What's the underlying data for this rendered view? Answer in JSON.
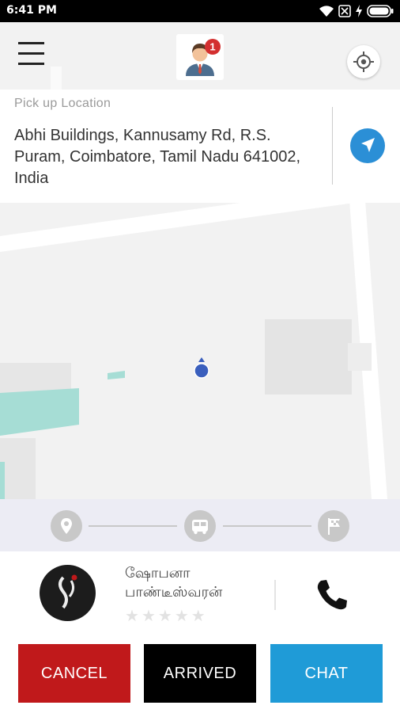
{
  "status_bar": {
    "time": "6:41 PM",
    "icons": [
      "wifi-icon",
      "sim-blocked-icon",
      "charging-icon",
      "battery-icon"
    ]
  },
  "header": {
    "menu_icon": "hamburger-menu-icon",
    "avatar_icon": "driver-avatar-icon",
    "notification_count": "1",
    "locate_icon": "my-location-icon"
  },
  "pickup": {
    "label": "Pick up Location",
    "address": "Abhi Buildings, Kannusamy Rd, R.S. Puram, Coimbatore, Tamil Nadu 641002, India",
    "navigate_icon": "navigation-arrow-icon"
  },
  "trip_progress": {
    "steps": [
      "location-pin-icon",
      "bus-icon",
      "finish-flag-icon"
    ]
  },
  "driver": {
    "name": "ஷோபனா பாண்டீஸ்வரன்",
    "rating_stars": 5,
    "rating_value": 0,
    "star_glyph": "★",
    "call_icon": "phone-icon"
  },
  "actions": {
    "cancel_label": "CANCEL",
    "arrived_label": "ARRIVED",
    "chat_label": "CHAT"
  },
  "colors": {
    "cancel": "#c0191b",
    "arrived": "#000000",
    "chat": "#1f9bd7",
    "accent_blue": "#2b8fd6",
    "notification_badge": "#d32f2f"
  }
}
